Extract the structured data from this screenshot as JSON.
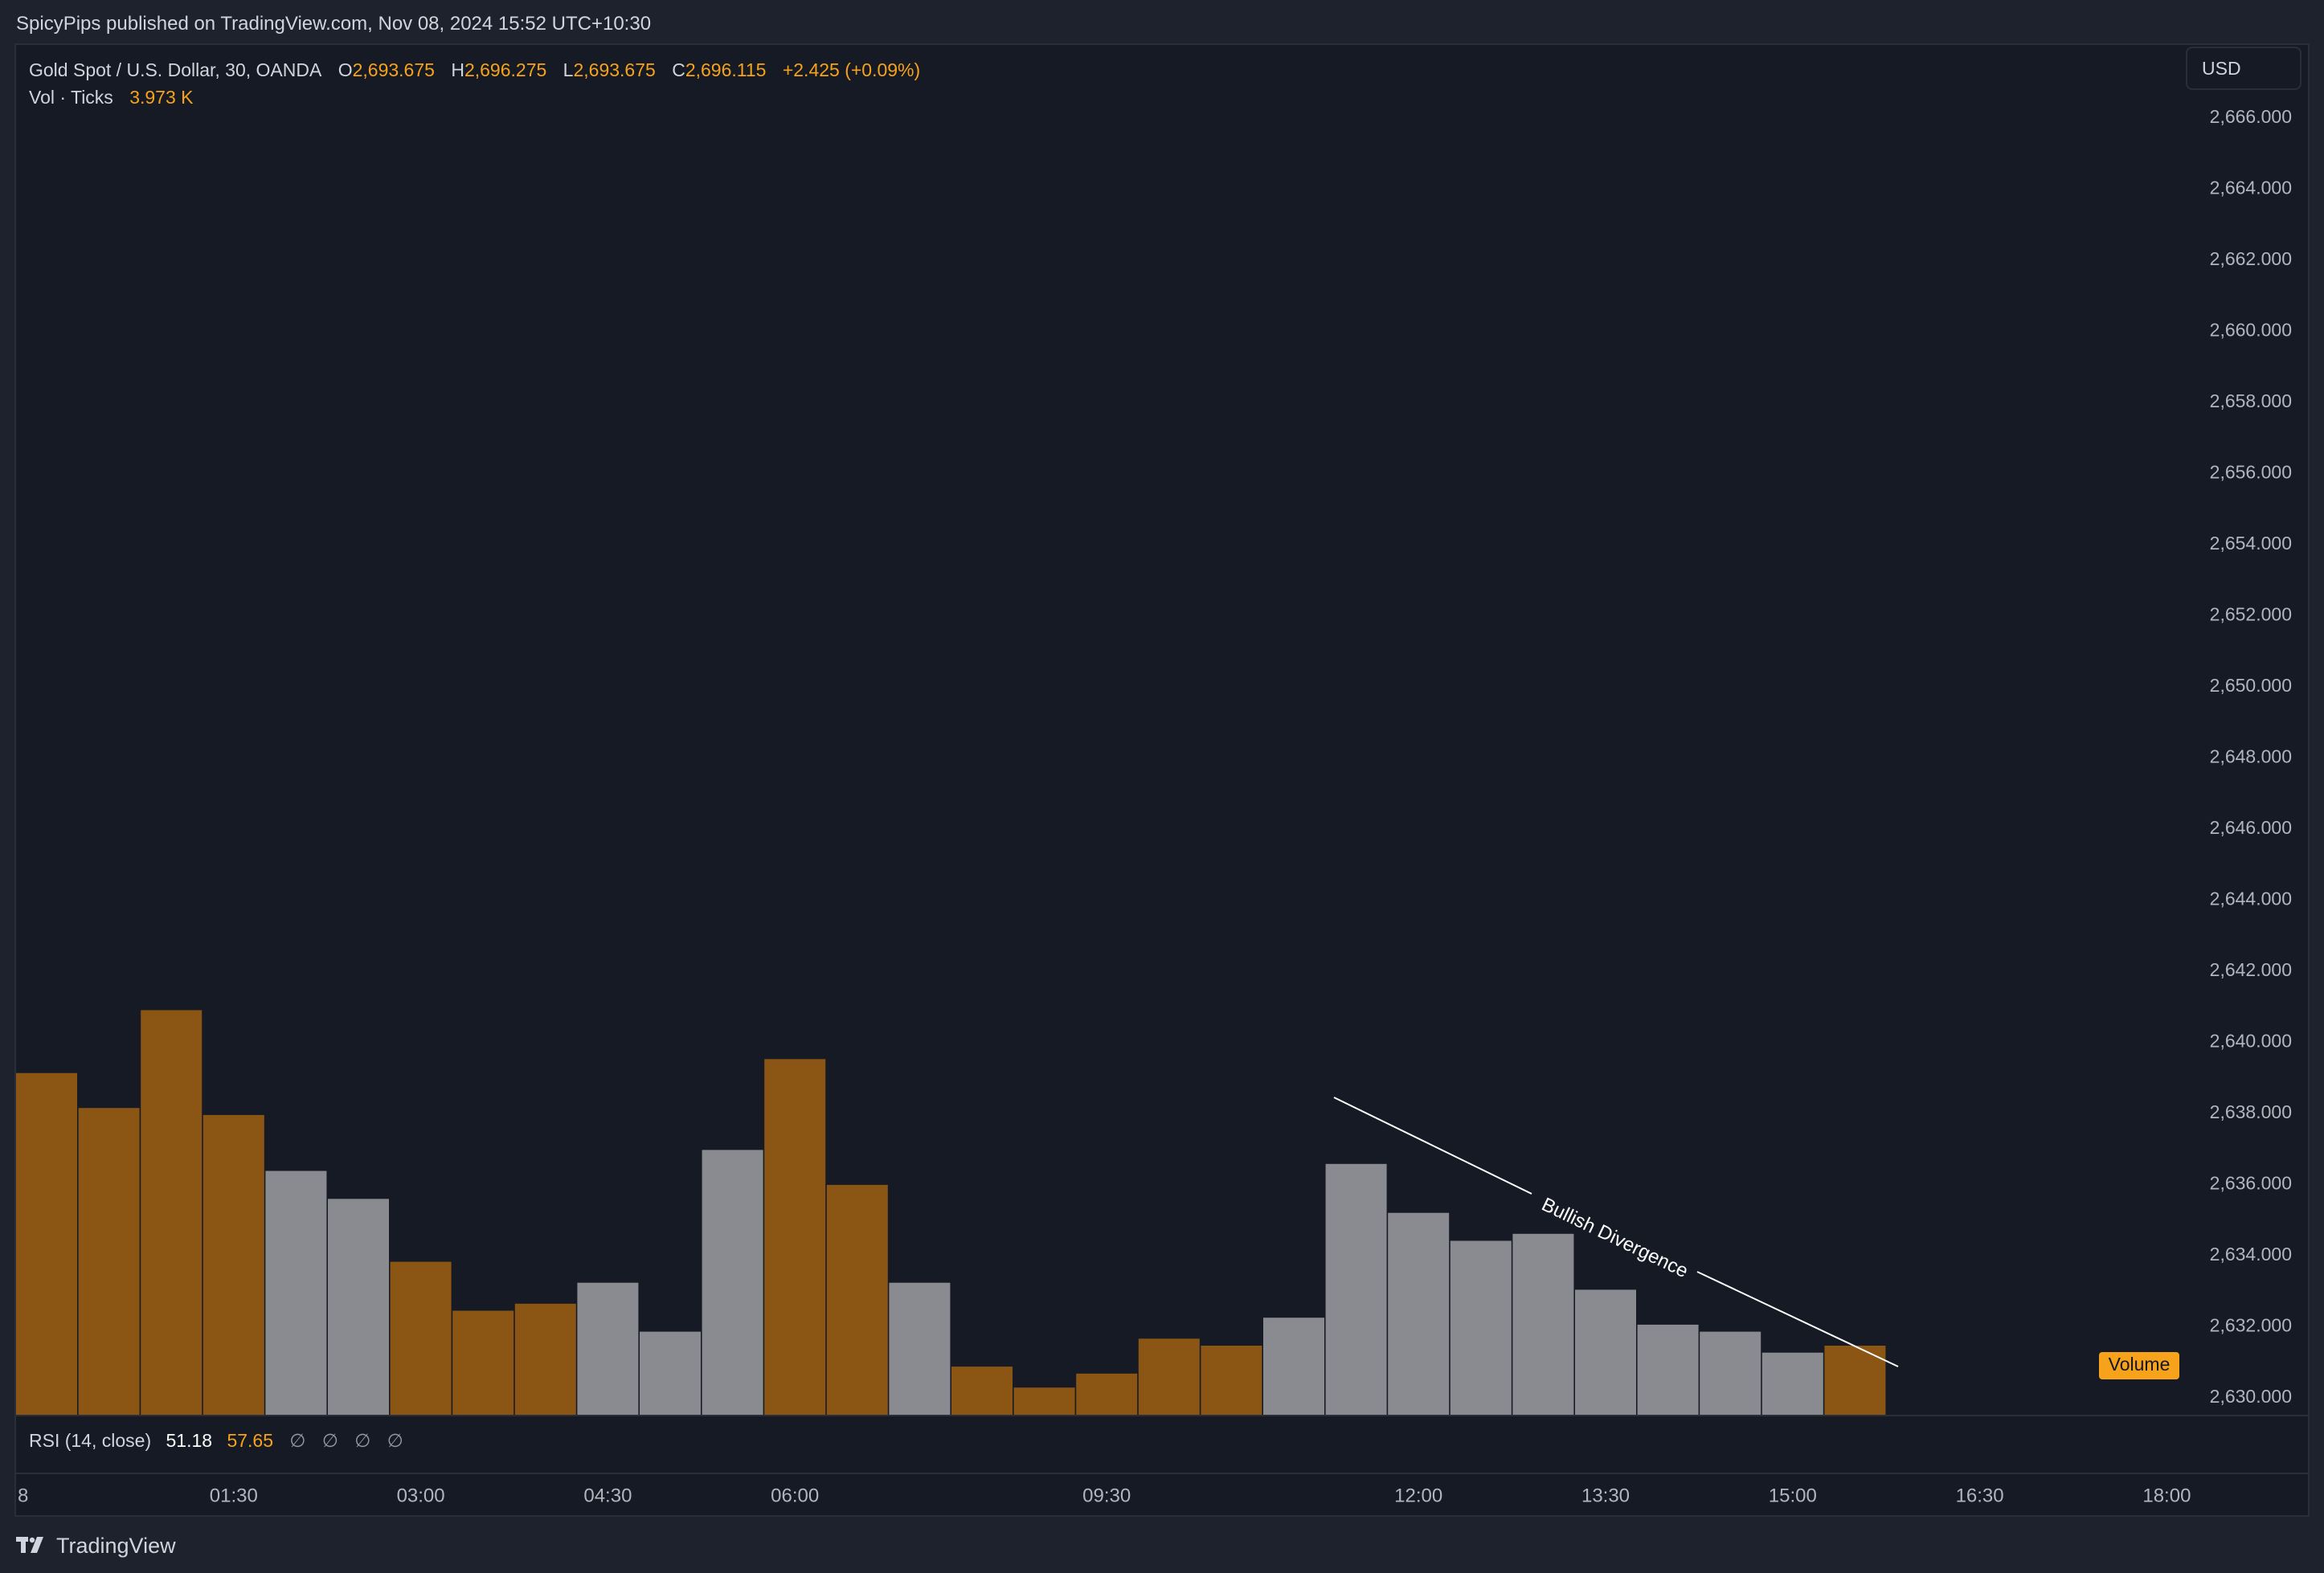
{
  "header": {
    "published": "SpicyPips published on TradingView.com, Nov 08, 2024 15:52 UTC+10:30"
  },
  "legend": {
    "symbol": "Gold Spot / U.S. Dollar, 30, OANDA",
    "open_prefix": "O",
    "open": "2,693.675",
    "high_prefix": "H",
    "high": "2,696.275",
    "low_prefix": "L",
    "low": "2,693.675",
    "close_prefix": "C",
    "close": "2,696.115",
    "change": "+2.425 (+0.09%)",
    "vol_label": "Vol · Ticks",
    "vol_value": "3.973 K"
  },
  "currency_button": "USD",
  "volume_tag": "Volume",
  "annotation": "Bullish Divergence",
  "rsi": {
    "label": "RSI (14, close)",
    "value1": "51.18",
    "value2": "57.65",
    "na": [
      "∅",
      "∅",
      "∅",
      "∅"
    ]
  },
  "footer": {
    "brand": "TradingView"
  },
  "colors": {
    "up_volume": "#8b5514",
    "down_volume": "#8a8b91",
    "background": "#161a25",
    "accent": "#f7a21b"
  },
  "chart_data": {
    "type": "bar",
    "y_axis": {
      "min": 2630,
      "max": 2666,
      "step": 2,
      "tick_labels": [
        "2,666.000",
        "2,664.000",
        "2,662.000",
        "2,660.000",
        "2,658.000",
        "2,656.000",
        "2,654.000",
        "2,652.000",
        "2,650.000",
        "2,648.000",
        "2,646.000",
        "2,644.000",
        "2,642.000",
        "2,640.000",
        "2,638.000",
        "2,636.000",
        "2,634.000",
        "2,632.000",
        "2,630.000"
      ]
    },
    "x_axis": {
      "tick_labels": [
        "8",
        "01:30",
        "03:00",
        "04:30",
        "06:00",
        "09:30",
        "12:00",
        "13:30",
        "15:00",
        "16:30",
        "18:00"
      ],
      "tick_bar_index": [
        0,
        3,
        6,
        9,
        12,
        17,
        22,
        25,
        28,
        31,
        34
      ]
    },
    "series": [
      {
        "name": "Vol · Ticks",
        "values": [
          4.9,
          4.4,
          5.8,
          4.3,
          3.5,
          3.1,
          2.2,
          1.5,
          1.6,
          1.9,
          1.2,
          3.8,
          5.1,
          3.3,
          1.9,
          0.7,
          0.4,
          0.6,
          1.1,
          1.0,
          1.4,
          3.6,
          2.9,
          2.5,
          2.6,
          1.8,
          1.3,
          1.2,
          0.9,
          1.0
        ],
        "direction": [
          "up",
          "up",
          "up",
          "up",
          "down",
          "down",
          "up",
          "up",
          "up",
          "down",
          "down",
          "down",
          "up",
          "up",
          "down",
          "up",
          "up",
          "up",
          "up",
          "up",
          "down",
          "down",
          "down",
          "down",
          "down",
          "down",
          "down",
          "down",
          "down",
          "up"
        ]
      }
    ],
    "volume_scale_max": 7.5
  }
}
